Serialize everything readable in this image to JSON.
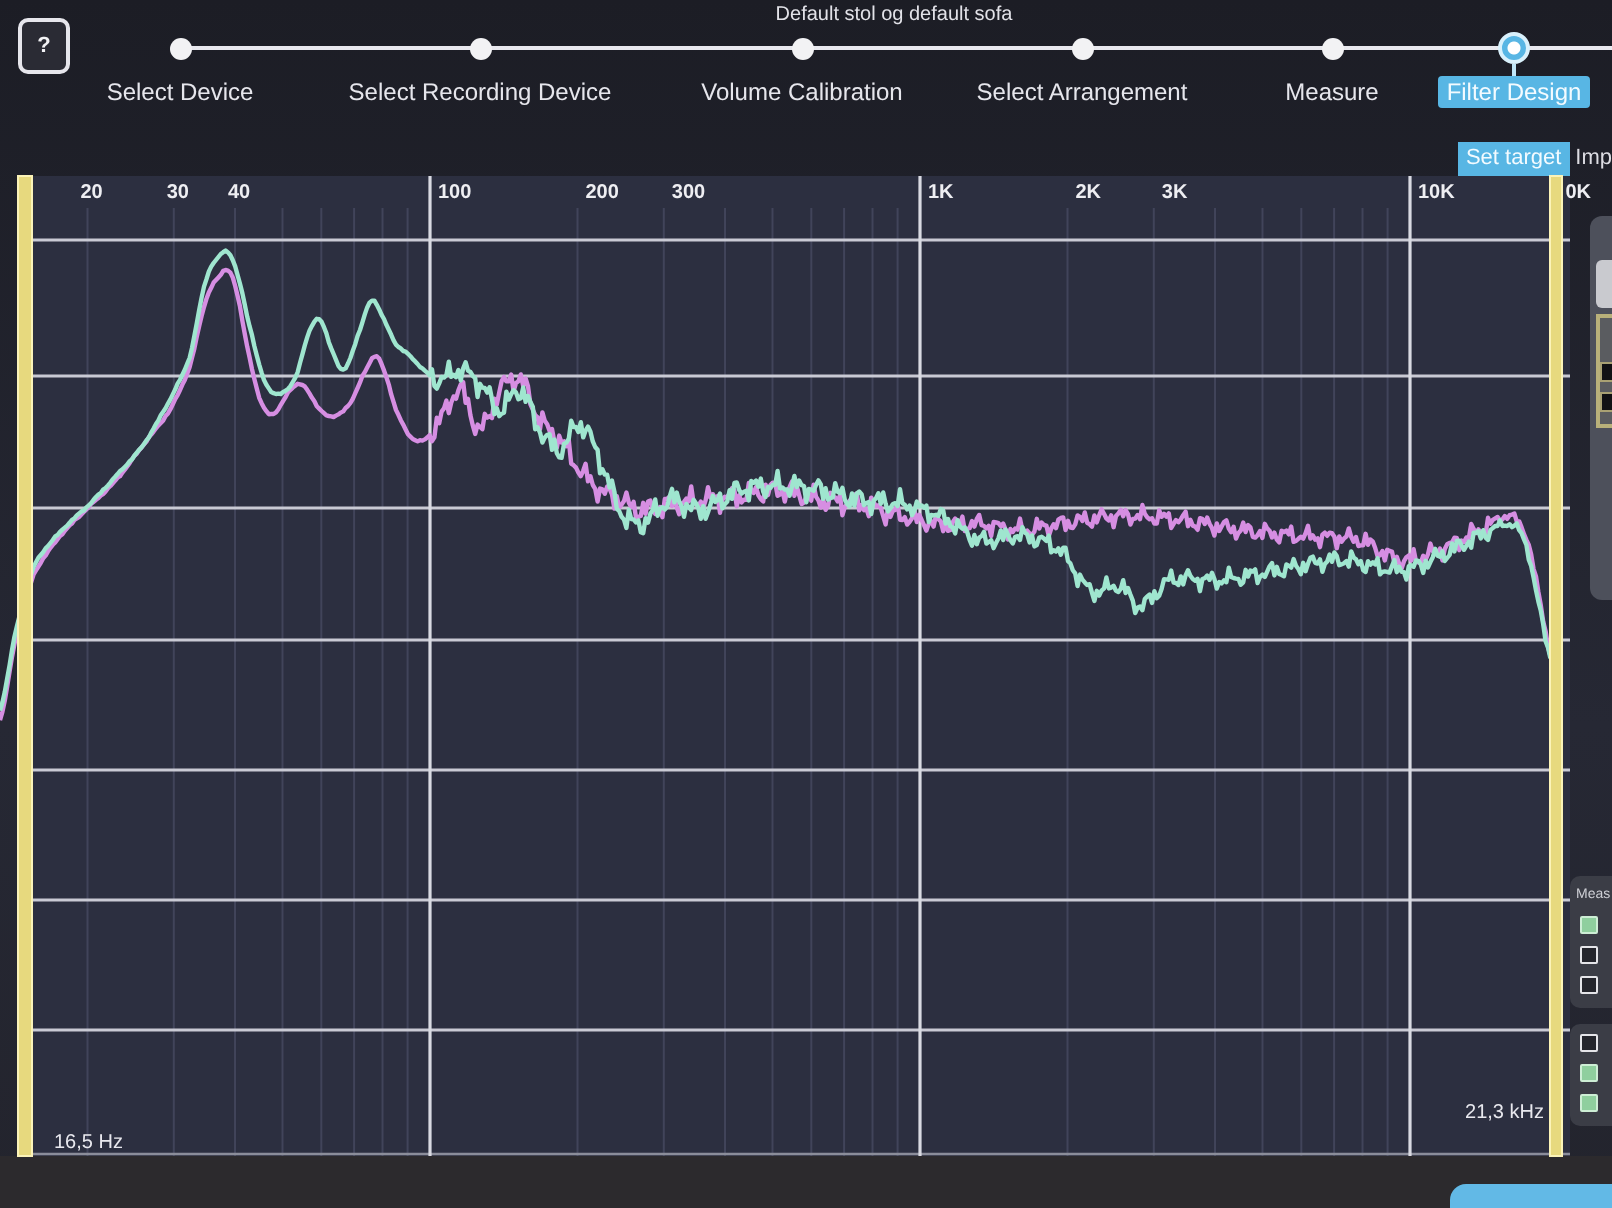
{
  "help_button": {
    "label": "?"
  },
  "title": "Default stol og default sofa",
  "steps": [
    {
      "label": "Select Device",
      "selected": false
    },
    {
      "label": "Select Recording Device",
      "selected": false
    },
    {
      "label": "Volume Calibration",
      "selected": false
    },
    {
      "label": "Select Arrangement",
      "selected": false
    },
    {
      "label": "Measure",
      "selected": false
    },
    {
      "label": "Filter Design",
      "selected": true
    }
  ],
  "subtabs": [
    {
      "label": "Set target",
      "selected": true
    },
    {
      "label": "Imp",
      "selected": false
    }
  ],
  "chart": {
    "frequency_labels": [
      "20",
      "30",
      "40",
      "100",
      "200",
      "300",
      "1K",
      "2K",
      "3K",
      "10K",
      "0K"
    ],
    "range_start": "16,5 Hz",
    "range_end": "21,3 kHz"
  },
  "side_panel": {
    "groups": [
      {
        "title": "Meas",
        "checkboxes": [
          {
            "checked": true
          },
          {
            "checked": false
          },
          {
            "checked": false
          }
        ]
      },
      {
        "checkboxes": [
          {
            "checked": false
          },
          {
            "checked": true
          },
          {
            "checked": true
          }
        ]
      }
    ]
  }
}
